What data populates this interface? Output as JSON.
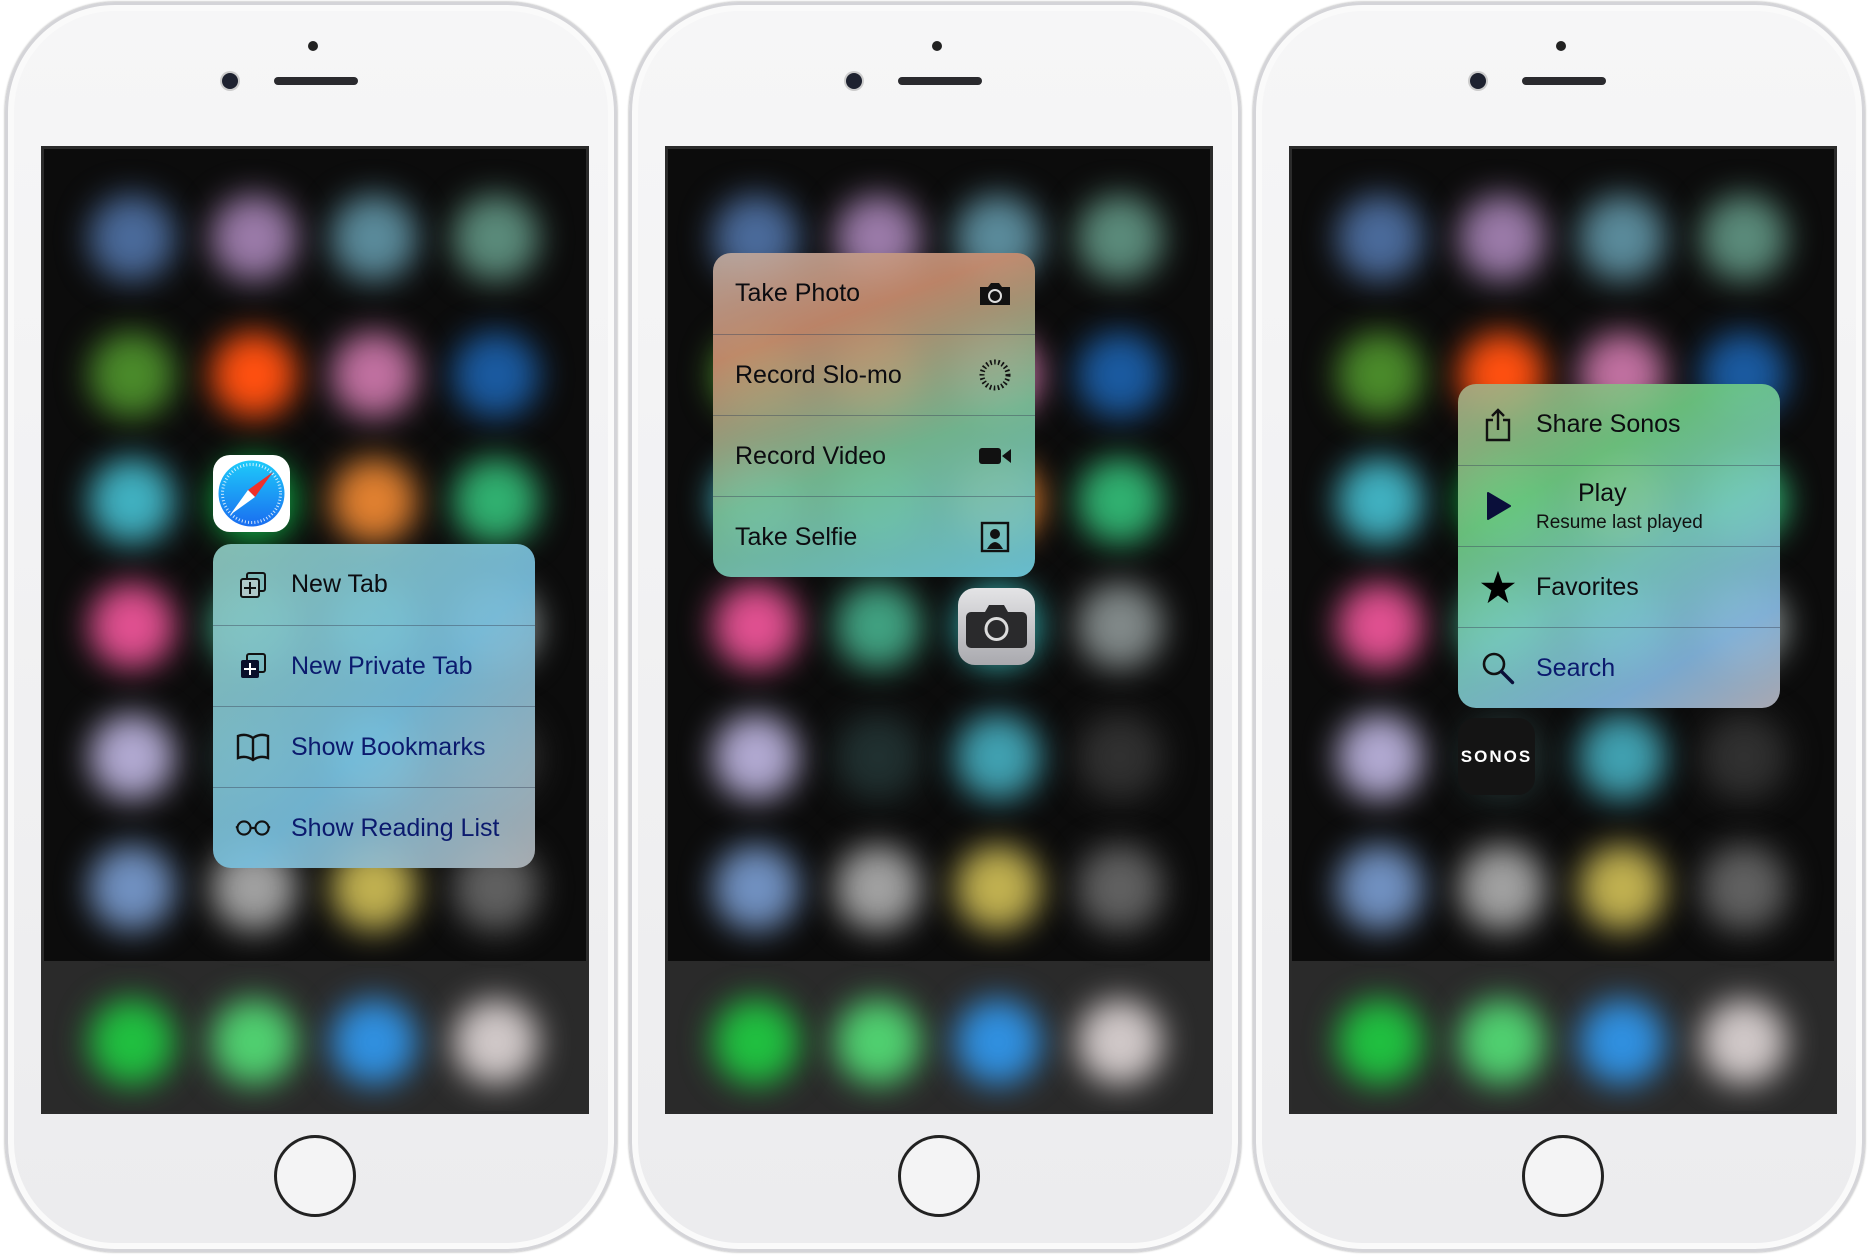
{
  "phones": [
    {
      "app": "Safari",
      "menu": [
        {
          "label": "New Tab",
          "icon": "new-tab-icon"
        },
        {
          "label": "New Private Tab",
          "icon": "new-private-tab-icon"
        },
        {
          "label": "Show Bookmarks",
          "icon": "book-icon"
        },
        {
          "label": "Show Reading List",
          "icon": "glasses-icon"
        }
      ]
    },
    {
      "app": "Camera",
      "menu": [
        {
          "label": "Take Photo",
          "icon": "camera-icon"
        },
        {
          "label": "Record Slo-mo",
          "icon": "slomo-icon"
        },
        {
          "label": "Record Video",
          "icon": "video-icon"
        },
        {
          "label": "Take Selfie",
          "icon": "selfie-icon"
        }
      ]
    },
    {
      "app": "Sonos",
      "logo_text": "SONOS",
      "menu": [
        {
          "label": "Share Sonos",
          "icon": "share-icon"
        },
        {
          "label": "Play",
          "sublabel": "Resume last played",
          "icon": "play-icon"
        },
        {
          "label": "Favorites",
          "icon": "star-icon"
        },
        {
          "label": "Search",
          "icon": "search-icon"
        }
      ]
    }
  ]
}
